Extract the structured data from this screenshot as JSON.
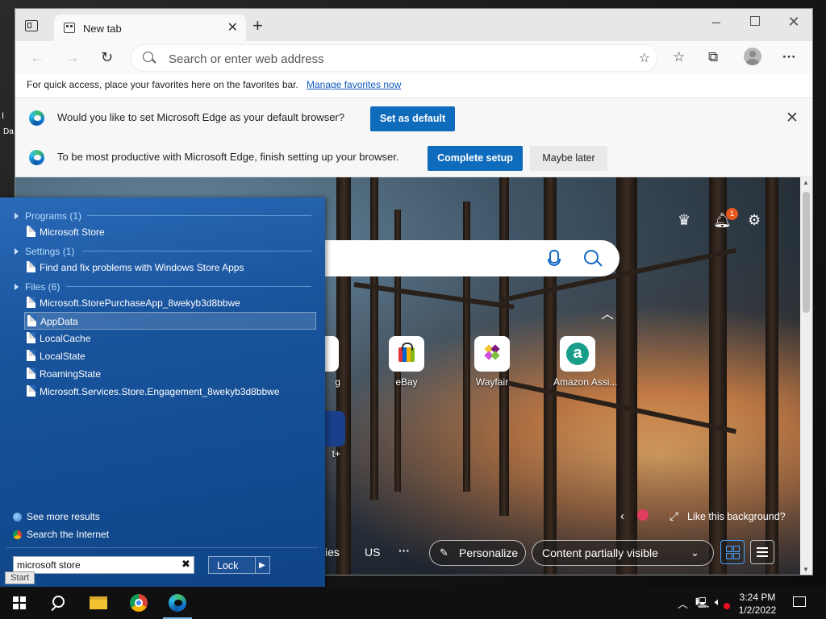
{
  "desktop": {
    "icon_fragment": "I",
    "icon_fragment2": "Da"
  },
  "browser": {
    "tab": {
      "title": "New tab"
    },
    "address": {
      "placeholder": "Search or enter web address"
    },
    "favorites_bar": {
      "message": "For quick access, place your favorites here on the favorites bar.",
      "link": "Manage favorites now"
    },
    "default_prompt": {
      "text": "Would you like to set Microsoft Edge as your default browser?",
      "button": "Set as default"
    },
    "setup_prompt": {
      "text": "To be most productive with Microsoft Edge, finish setting up your browser.",
      "primary": "Complete setup",
      "secondary": "Maybe later"
    },
    "ntp": {
      "notification_count": "1",
      "tiles": [
        {
          "label": "g"
        },
        {
          "label": "eBay"
        },
        {
          "label": "Wayfair"
        },
        {
          "label": "Amazon Assi..."
        },
        {
          "label": "t+"
        }
      ],
      "like_background": "Like this background?",
      "bottom": {
        "partial": "ies",
        "region": "US",
        "more": "···",
        "personalize": "Personalize",
        "content": "Content partially visible"
      }
    }
  },
  "start_search": {
    "groups": [
      {
        "label": "Programs (1)"
      },
      {
        "label": "Settings (1)"
      },
      {
        "label": "Files (6)"
      }
    ],
    "programs": [
      "Microsoft Store"
    ],
    "settings": [
      "Find and fix problems with Windows Store Apps"
    ],
    "files": [
      "Microsoft.StorePurchaseApp_8wekyb3d8bbwe",
      "AppData",
      "LocalCache",
      "LocalState",
      "RoamingState",
      "Microsoft.Services.Store.Engagement_8wekyb3d8bbwe"
    ],
    "see_more": "See more results",
    "search_internet": "Search the Internet",
    "query": "microsoft store",
    "clear": "✖",
    "lock": "Lock",
    "start_tooltip": "Start"
  },
  "taskbar": {
    "clock_time": "3:24 PM",
    "clock_date": "1/2/2022"
  }
}
